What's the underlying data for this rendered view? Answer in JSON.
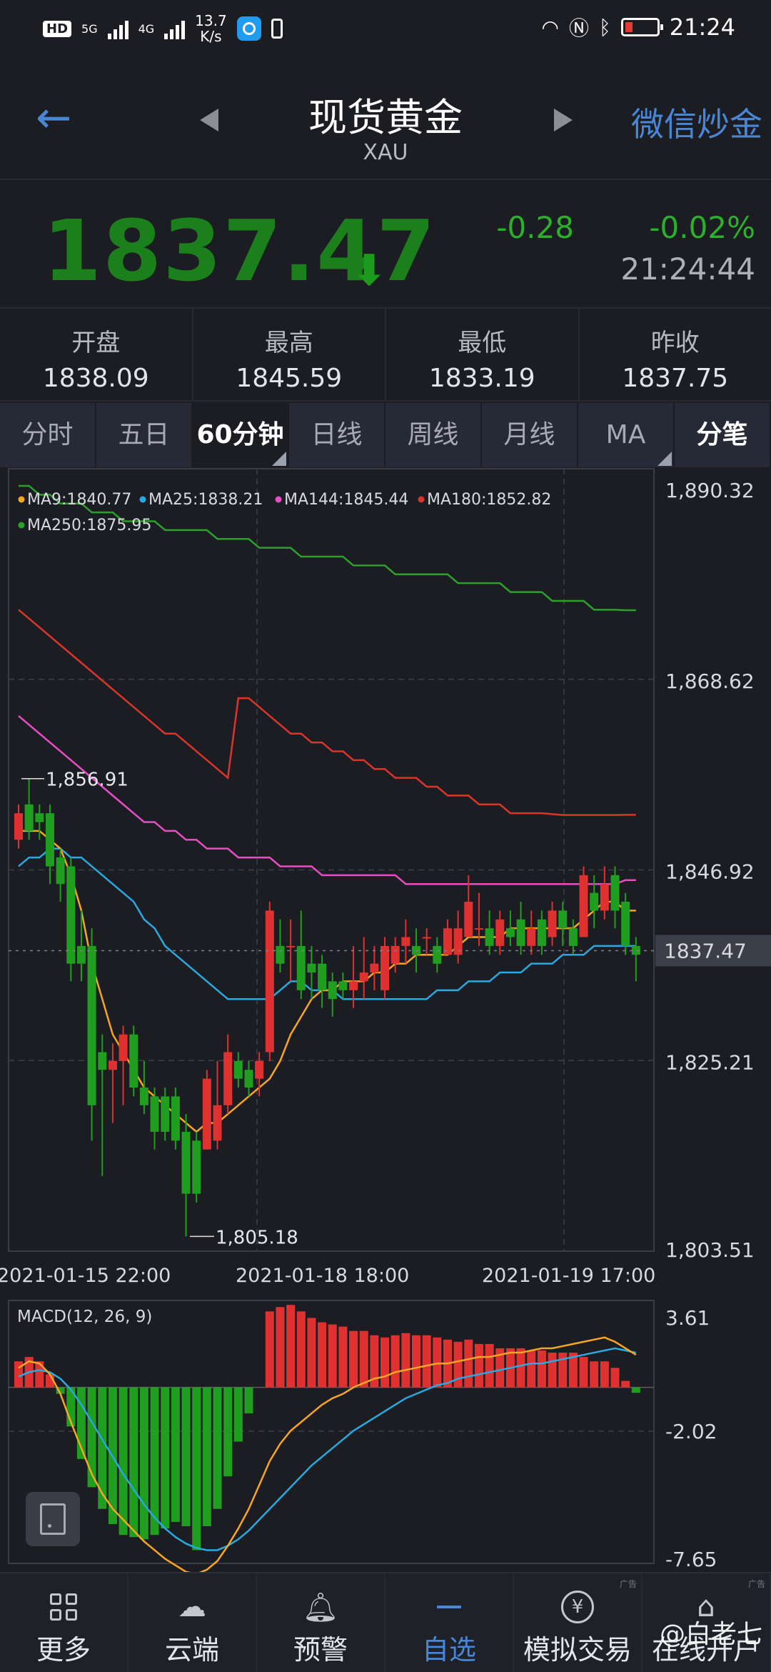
{
  "status_bar": {
    "hd_badge": "HD",
    "net1": "5G",
    "net2": "4G",
    "speed_value": "13.7",
    "speed_unit": "K/s",
    "time": "21:24"
  },
  "header": {
    "title": "现货黄金",
    "subtitle": "XAU",
    "right_link": "微信炒金"
  },
  "quote": {
    "price": "1837.47",
    "change": "-0.28",
    "change_pct": "-0.02%",
    "time": "21:24:44"
  },
  "ohlc": [
    {
      "label": "开盘",
      "value": "1838.09"
    },
    {
      "label": "最高",
      "value": "1845.59"
    },
    {
      "label": "最低",
      "value": "1833.19"
    },
    {
      "label": "昨收",
      "value": "1837.75"
    }
  ],
  "tabs": [
    {
      "label": "分时"
    },
    {
      "label": "五日"
    },
    {
      "label": "60分钟"
    },
    {
      "label": "日线"
    },
    {
      "label": "周线"
    },
    {
      "label": "月线"
    },
    {
      "label": "MA"
    },
    {
      "label": "分笔"
    }
  ],
  "colors": {
    "up": "#e03131",
    "down": "#1f9e1f",
    "ma9": "#f5a623",
    "ma25": "#29a9e0",
    "ma144": "#e64fc4",
    "ma180": "#d9352b",
    "ma250": "#2ca02c",
    "accent": "#4a86d6"
  },
  "chart_data": [
    {
      "type": "candlestick",
      "legend": [
        {
          "label": "MA9:1840.77",
          "color": "#f5a623"
        },
        {
          "label": "MA25:1838.21",
          "color": "#29a9e0"
        },
        {
          "label": "MA144:1845.44",
          "color": "#e64fc4"
        },
        {
          "label": "MA180:1852.82",
          "color": "#d9352b"
        },
        {
          "label": "MA250:1875.95",
          "color": "#2ca02c"
        }
      ],
      "y_ticks": [
        "1,890.32",
        "1,868.62",
        "1,846.92",
        "1,825.21",
        "1,803.51"
      ],
      "ylim": [
        1803.51,
        1890.32
      ],
      "x_ticks": [
        "2021-01-15 22:00",
        "2021-01-18 18:00",
        "2021-01-19 17:00"
      ],
      "current_price_label": "1837.47",
      "current_price": 1837.47,
      "max_label": "1,856.91",
      "min_label": "1,805.18",
      "candles": [
        [
          1850,
          1853,
          1849,
          1854
        ],
        [
          1854,
          1851,
          1850,
          1856.91
        ],
        [
          1853,
          1852,
          1850,
          1854
        ],
        [
          1853,
          1847,
          1845,
          1854
        ],
        [
          1848,
          1845,
          1843,
          1849
        ],
        [
          1847,
          1836,
          1834,
          1848
        ],
        [
          1838,
          1836,
          1834,
          1842
        ],
        [
          1838,
          1820,
          1816,
          1840
        ],
        [
          1826,
          1824,
          1812,
          1828
        ],
        [
          1824,
          1825,
          1818,
          1827
        ],
        [
          1825,
          1828,
          1820,
          1829
        ],
        [
          1828,
          1822,
          1821,
          1829
        ],
        [
          1822,
          1820,
          1819,
          1825
        ],
        [
          1821,
          1817,
          1815,
          1822
        ],
        [
          1821,
          1817,
          1816,
          1822
        ],
        [
          1821,
          1816,
          1815,
          1822
        ],
        [
          1817,
          1810,
          1805.18,
          1819
        ],
        [
          1816,
          1810,
          1809,
          1817
        ],
        [
          1815,
          1823,
          1815,
          1824
        ],
        [
          1816,
          1820,
          1815,
          1825
        ],
        [
          1820,
          1826,
          1819,
          1828
        ],
        [
          1825,
          1823,
          1822,
          1826
        ],
        [
          1824,
          1822,
          1821,
          1825
        ],
        [
          1823,
          1825,
          1821,
          1826
        ],
        [
          1826,
          1842,
          1825,
          1843
        ],
        [
          1838,
          1836,
          1835,
          1841
        ],
        [
          1838,
          1838,
          1834,
          1841
        ],
        [
          1838,
          1833,
          1832,
          1842
        ],
        [
          1836,
          1835,
          1832,
          1838
        ],
        [
          1836,
          1833,
          1831,
          1837
        ],
        [
          1834,
          1832,
          1830,
          1835
        ],
        [
          1834,
          1833,
          1832,
          1835
        ],
        [
          1833,
          1834,
          1831,
          1838
        ],
        [
          1834,
          1835,
          1832,
          1839
        ],
        [
          1835,
          1836,
          1833,
          1838
        ],
        [
          1833,
          1838,
          1832,
          1839
        ],
        [
          1836,
          1838,
          1835,
          1839
        ],
        [
          1838,
          1839,
          1836,
          1841
        ],
        [
          1838,
          1837,
          1835,
          1840
        ],
        [
          1839,
          1839,
          1837,
          1840
        ],
        [
          1838,
          1836,
          1835,
          1839
        ],
        [
          1837,
          1840,
          1837,
          1841
        ],
        [
          1837,
          1840,
          1836,
          1842
        ],
        [
          1839,
          1843,
          1839,
          1846
        ],
        [
          1840,
          1840,
          1838,
          1844
        ],
        [
          1840,
          1838,
          1837,
          1842
        ],
        [
          1838,
          1841,
          1837,
          1842
        ],
        [
          1840,
          1839,
          1838,
          1842
        ],
        [
          1841,
          1838,
          1837,
          1843
        ],
        [
          1838,
          1840,
          1837,
          1842
        ],
        [
          1841,
          1838,
          1837,
          1842
        ],
        [
          1839,
          1842,
          1838,
          1843
        ],
        [
          1842,
          1840,
          1838,
          1843
        ],
        [
          1840,
          1838,
          1837,
          1841
        ],
        [
          1839,
          1846,
          1839,
          1847
        ],
        [
          1844,
          1842,
          1840,
          1846
        ],
        [
          1842,
          1845,
          1841,
          1847
        ],
        [
          1846,
          1842,
          1840,
          1847
        ],
        [
          1843,
          1838,
          1837,
          1844
        ],
        [
          1838,
          1837,
          1834,
          1839
        ]
      ],
      "ma9": [
        1851,
        1851,
        1851,
        1850,
        1849,
        1846,
        1842,
        1836,
        1832,
        1828,
        1826,
        1824,
        1822,
        1821,
        1820,
        1819,
        1818,
        1817,
        1818,
        1818,
        1819,
        1820,
        1821,
        1822,
        1823,
        1825,
        1828,
        1830,
        1832,
        1833,
        1833,
        1834,
        1834,
        1834,
        1835,
        1835,
        1836,
        1836,
        1837,
        1837,
        1837,
        1837,
        1838,
        1839,
        1839,
        1839,
        1839,
        1840,
        1840,
        1840,
        1840,
        1840,
        1840,
        1840,
        1841,
        1842,
        1843,
        1843,
        1842,
        1842
      ],
      "ma25": [
        1847,
        1848,
        1848,
        1849,
        1849,
        1848,
        1848,
        1847,
        1846,
        1845,
        1844,
        1843,
        1841,
        1840,
        1838,
        1837,
        1836,
        1835,
        1834,
        1833,
        1832,
        1832,
        1832,
        1832,
        1832,
        1833,
        1834,
        1834,
        1833,
        1833,
        1833,
        1832,
        1832,
        1832,
        1832,
        1832,
        1832,
        1832,
        1832,
        1832,
        1833,
        1833,
        1833,
        1834,
        1834,
        1834,
        1835,
        1835,
        1835,
        1836,
        1836,
        1836,
        1837,
        1837,
        1837,
        1838,
        1838,
        1838,
        1838,
        1838
      ],
      "ma144": [
        1864,
        1863,
        1862,
        1861,
        1860,
        1859,
        1858,
        1857,
        1856,
        1855,
        1854,
        1853,
        1852,
        1852,
        1851,
        1851,
        1850,
        1850,
        1849,
        1849,
        1849,
        1848,
        1848,
        1848,
        1848,
        1847,
        1847,
        1847,
        1847,
        1846,
        1846,
        1846,
        1846,
        1846,
        1846,
        1846,
        1846,
        1845,
        1845,
        1845,
        1845,
        1845,
        1845,
        1845,
        1845,
        1845,
        1845,
        1845,
        1845,
        1845,
        1845,
        1845,
        1845,
        1845,
        1845,
        1845,
        1845,
        1845,
        1845.44,
        1845.44
      ],
      "ma180": [
        1876,
        1875,
        1874,
        1873,
        1872,
        1871,
        1870,
        1869,
        1868,
        1867,
        1866,
        1865,
        1864,
        1863,
        1862,
        1862,
        1861,
        1860,
        1859,
        1858,
        1857,
        1866,
        1866,
        1865,
        1864,
        1863,
        1862,
        1862,
        1861,
        1861,
        1860,
        1860,
        1859,
        1859,
        1858,
        1858,
        1857,
        1857,
        1857,
        1856,
        1856,
        1855,
        1855,
        1855,
        1854,
        1854,
        1854,
        1853,
        1853,
        1853,
        1853,
        1852.9,
        1852.8,
        1852.8,
        1852.8,
        1852.8,
        1852.8,
        1852.8,
        1852.82,
        1852.82
      ],
      "ma250": [
        1890,
        1890,
        1889,
        1889,
        1888,
        1888,
        1888,
        1887,
        1887,
        1887,
        1886,
        1886,
        1886,
        1886,
        1885,
        1885,
        1885,
        1885,
        1885,
        1884,
        1884,
        1884,
        1884,
        1883,
        1883,
        1883,
        1883,
        1882,
        1882,
        1882,
        1882,
        1882,
        1881,
        1881,
        1881,
        1881,
        1880,
        1880,
        1880,
        1880,
        1880,
        1880,
        1879,
        1879,
        1879,
        1879,
        1879,
        1878,
        1878,
        1878,
        1878,
        1877,
        1877,
        1877,
        1877,
        1876,
        1876,
        1876,
        1875.95,
        1875.95
      ]
    },
    {
      "type": "macd",
      "title": "MACD(12, 26, 9)",
      "y_ticks": [
        "3.61",
        "-2.02",
        "-7.65"
      ],
      "ylim": [
        -7.65,
        3.61
      ],
      "hist": [
        1.2,
        1.4,
        1.2,
        0.6,
        -0.3,
        -1.8,
        -3.3,
        -4.6,
        -5.6,
        -6.3,
        -6.8,
        -6.9,
        -7.0,
        -6.8,
        -6.5,
        -6.2,
        -6.4,
        -7.5,
        -6.4,
        -5.6,
        -4.1,
        -2.5,
        -1.2,
        0.0,
        3.5,
        3.7,
        3.8,
        3.5,
        3.2,
        3.0,
        2.9,
        2.8,
        2.6,
        2.6,
        2.4,
        2.3,
        2.4,
        2.5,
        2.4,
        2.4,
        2.3,
        2.2,
        2.1,
        2.2,
        2.0,
        2.0,
        1.8,
        1.8,
        1.8,
        1.7,
        1.7,
        1.6,
        1.6,
        1.6,
        1.4,
        1.2,
        1.2,
        0.9,
        0.3,
        -0.25
      ],
      "dif": [
        0.9,
        1.2,
        1.1,
        0.6,
        -0.3,
        -1.6,
        -2.8,
        -4.0,
        -4.9,
        -5.6,
        -6.1,
        -6.6,
        -7.1,
        -7.5,
        -7.9,
        -8.2,
        -8.5,
        -8.6,
        -8.4,
        -8.0,
        -7.3,
        -6.5,
        -5.6,
        -4.5,
        -3.4,
        -2.6,
        -2.0,
        -1.6,
        -1.2,
        -0.8,
        -0.5,
        -0.3,
        0.0,
        0.2,
        0.4,
        0.5,
        0.7,
        0.8,
        0.9,
        1.0,
        1.1,
        1.1,
        1.2,
        1.3,
        1.4,
        1.4,
        1.5,
        1.6,
        1.6,
        1.7,
        1.8,
        1.8,
        1.9,
        2.0,
        2.1,
        2.2,
        2.3,
        2.1,
        1.8,
        1.5
      ],
      "dea": [
        0.5,
        0.7,
        0.8,
        0.7,
        0.4,
        -0.1,
        -0.8,
        -1.6,
        -2.4,
        -3.2,
        -4.0,
        -4.7,
        -5.4,
        -6.0,
        -6.5,
        -6.9,
        -7.2,
        -7.4,
        -7.5,
        -7.5,
        -7.3,
        -7.0,
        -6.6,
        -6.1,
        -5.6,
        -5.1,
        -4.6,
        -4.1,
        -3.6,
        -3.2,
        -2.8,
        -2.4,
        -2.0,
        -1.7,
        -1.4,
        -1.1,
        -0.8,
        -0.5,
        -0.3,
        -0.1,
        0.1,
        0.2,
        0.4,
        0.5,
        0.6,
        0.7,
        0.8,
        0.9,
        1.0,
        1.1,
        1.1,
        1.2,
        1.3,
        1.4,
        1.5,
        1.6,
        1.7,
        1.8,
        1.7,
        1.6
      ]
    }
  ],
  "bottom_nav": [
    {
      "label": "更多",
      "icon": "grid-icon"
    },
    {
      "label": "云端",
      "icon": "cloud-icon"
    },
    {
      "label": "预警",
      "icon": "bell-icon"
    },
    {
      "label": "自选",
      "icon": "dash-icon"
    },
    {
      "label": "模拟交易",
      "icon": "yen-icon"
    },
    {
      "label": "在线开户",
      "icon": "bank-icon"
    }
  ],
  "ad_tag": "广告",
  "watermark": "@白老七"
}
